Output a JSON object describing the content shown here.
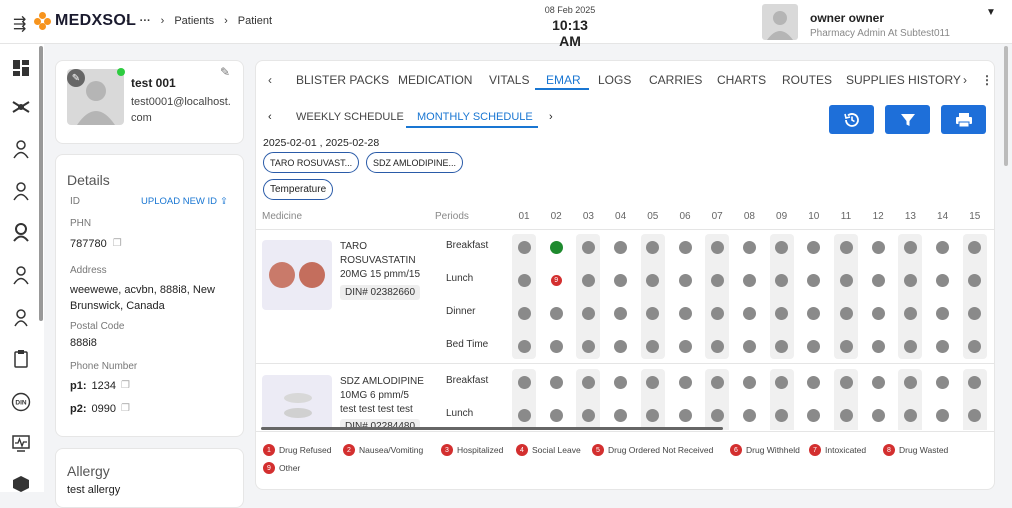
{
  "app": {
    "brand": "MEDXSOL",
    "breadcrumbs": [
      "Patients",
      "Patient"
    ],
    "date": "08 Feb 2025",
    "time": "10:13 AM"
  },
  "user": {
    "name": "owner owner",
    "role": "Pharmacy Admin At Subtest011"
  },
  "patient": {
    "name": "test 001",
    "email": "test0001@localhost.com"
  },
  "details": {
    "title": "Details",
    "id_label": "ID",
    "upload_label": "UPLOAD NEW ID",
    "phn_label": "PHN",
    "phn": "787780",
    "address_label": "Address",
    "address": "weewewe, acvbn, 888i8, New Brunswick, Canada",
    "postal_label": "Postal Code",
    "postal": "888i8",
    "phone_label": "Phone Number",
    "p1_label": "p1:",
    "p1": "1234",
    "p2_label": "p2:",
    "p2": "0990"
  },
  "allergy": {
    "title": "Allergy",
    "text": "test allergy"
  },
  "tabs": [
    "BLISTER PACKS",
    "MEDICATION",
    "VITALS",
    "EMAR",
    "LOGS",
    "CARRIES",
    "CHARTS",
    "ROUTES",
    "SUPPLIES HISTORY"
  ],
  "active_tab": "EMAR",
  "subtabs": [
    "WEEKLY SCHEDULE",
    "MONTHLY SCHEDULE"
  ],
  "date_range": "2025-02-01 , 2025-02-28",
  "filters": [
    "TARO ROSUVAST...",
    "SDZ AMLODIPINE...",
    "Temperature"
  ],
  "grid": {
    "medicine_header": "Medicine",
    "periods_header": "Periods",
    "days": [
      "01",
      "02",
      "03",
      "04",
      "05",
      "06",
      "07",
      "08",
      "09",
      "10",
      "11",
      "12",
      "13",
      "14",
      "15"
    ]
  },
  "medicines": [
    {
      "name_lines": [
        "TARO",
        "ROSUVASTATIN",
        "20MG 15 pmm/15"
      ],
      "din": "DIN# 02382660",
      "periods": [
        "Breakfast",
        "Lunch",
        "Dinner",
        "Bed Time"
      ],
      "status": {
        "Breakfast": {
          "02": "taken"
        },
        "Lunch": {
          "02": "9"
        }
      }
    },
    {
      "name_lines": [
        "SDZ AMLODIPINE",
        "10MG 6 pmm/5",
        "test test test test"
      ],
      "din": "DIN# 02284480",
      "periods": [
        "Breakfast",
        "Lunch"
      ],
      "status": {}
    }
  ],
  "legend": [
    {
      "n": "1",
      "label": "Drug Refused"
    },
    {
      "n": "2",
      "label": "Nausea/Vomiting"
    },
    {
      "n": "3",
      "label": "Hospitalized"
    },
    {
      "n": "4",
      "label": "Social Leave"
    },
    {
      "n": "5",
      "label": "Drug Ordered Not Received"
    },
    {
      "n": "6",
      "label": "Drug Withheld"
    },
    {
      "n": "7",
      "label": "Intoxicated"
    },
    {
      "n": "8",
      "label": "Drug Wasted"
    },
    {
      "n": "9",
      "label": "Other"
    }
  ],
  "colors": {
    "accent": "#1976d2",
    "button": "#1e6fd9",
    "taken": "#1e8a2e",
    "reason": "#d32f2f",
    "pending": "#8a8a8a"
  }
}
